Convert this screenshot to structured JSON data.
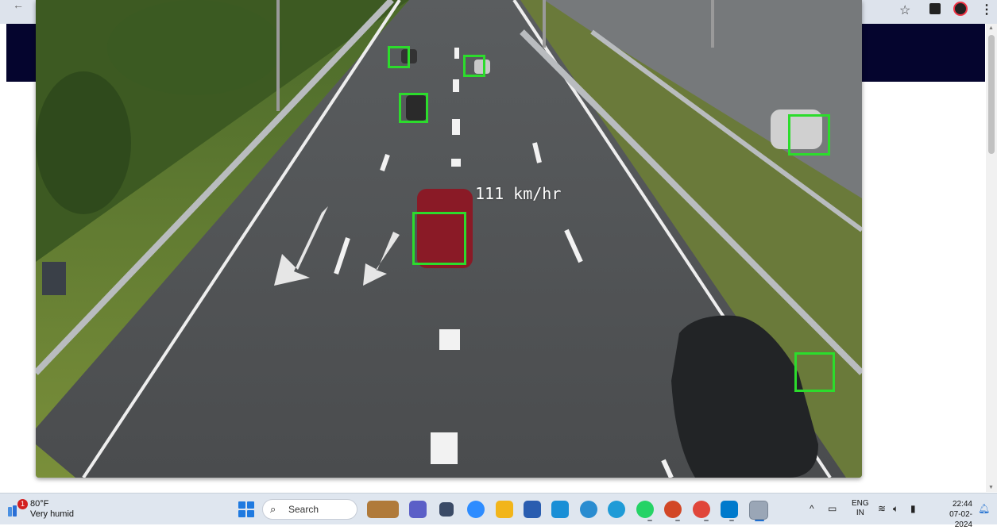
{
  "browser": {
    "back_icon": "arrow-left-icon",
    "star_icon": "star-icon",
    "menu_icon": "kebab-menu-icon"
  },
  "video": {
    "speed_label": "111 km/hr",
    "box_color": "#2cdc2c"
  },
  "taskbar": {
    "weather": {
      "alert_count": "1",
      "temperature": "80°F",
      "condition": "Very humid"
    },
    "search_placeholder": "Search",
    "apps": [
      "copilot-icon",
      "teams-icon",
      "task-view-icon",
      "zoom-icon",
      "file-explorer-icon",
      "microsoft-store-icon",
      "mail-icon",
      "settings-icon",
      "edge-icon",
      "whatsapp-icon",
      "powerpoint-icon",
      "chrome-icon",
      "vscode-icon",
      "active-app-icon"
    ],
    "tray": {
      "language_line1": "ENG",
      "language_line2": "IN",
      "time": "22:44",
      "date": "07-02-2024"
    }
  }
}
